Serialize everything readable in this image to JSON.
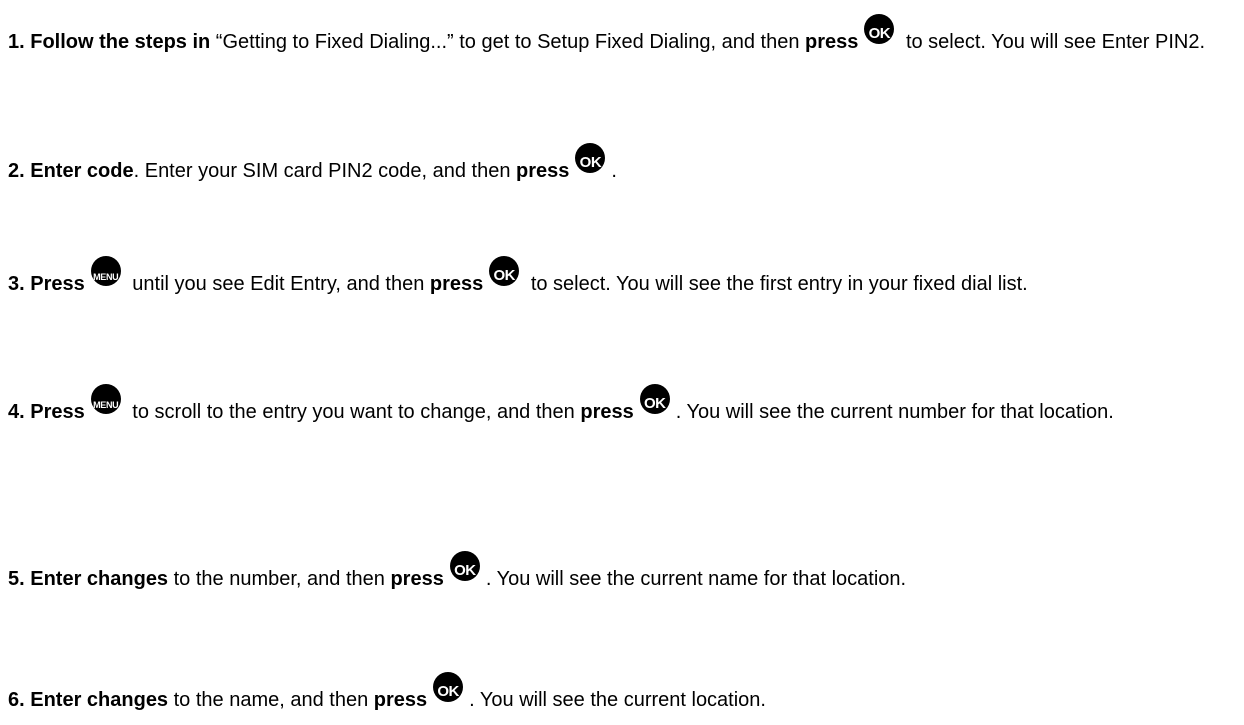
{
  "keys": {
    "ok": "OK",
    "menu": "MENU"
  },
  "steps": [
    {
      "parts": [
        "1. Follow the steps in",
        " “Getting to Fixed Dialing...” to get to Setup Fixed Dialing, and then ",
        "press",
        " to select. You will see Enter PIN2."
      ]
    },
    {
      "parts": [
        "2. Enter code",
        ". Enter your SIM card PIN2 code, and then ",
        "press",
        "."
      ]
    },
    {
      "parts": [
        "3. Press",
        " until you see Edit Entry, and then ",
        "press",
        " to select. You will see the first entry in your fixed dial list."
      ]
    },
    {
      "parts": [
        "4. Press",
        " to scroll to the entry you want to change, and then ",
        "press",
        ". You will see the current number for that location."
      ]
    },
    {
      "parts": [
        "5. Enter changes",
        " to the number, and then ",
        "press",
        ". You will see the current name for that location."
      ]
    },
    {
      "parts": [
        "6. Enter changes",
        " to the name, and then ",
        "press",
        ". You will see the current location."
      ]
    }
  ]
}
